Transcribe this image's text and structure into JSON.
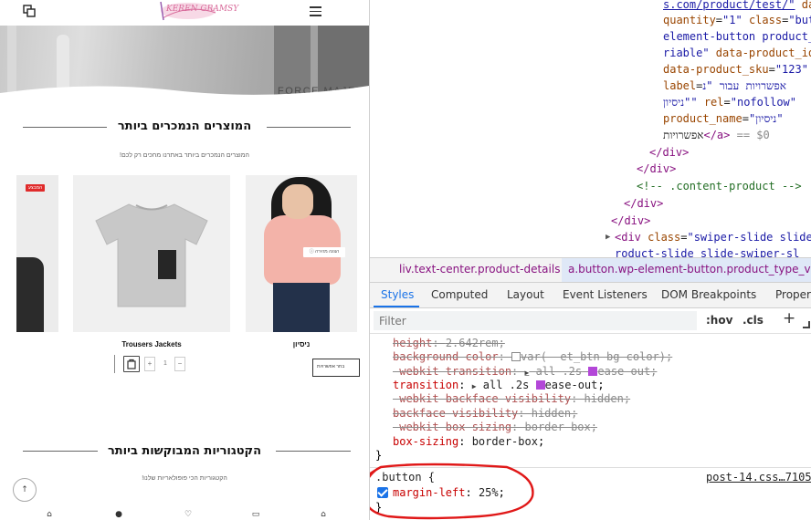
{
  "site": {
    "logo_text": "KEREN GRAMSY",
    "hero_text": "FORCE MAJEUR",
    "best_sellers_title": "המוצרים הנמכרים ביותר",
    "best_sellers_sub": "המוצרים הנמכרים ביותר באתרנו מחכים רק לכם!",
    "sale_badge": "המבצע",
    "product_2_name": "Trousers Jackets",
    "product_3_name": "ניסיון",
    "quick_view": "הצגה מהירה",
    "qty_plus": "+",
    "qty_value": "1",
    "qty_minus": "−",
    "options_label": "בחר אפשרויות",
    "categories_title": "הקטגוריות המבוקשות ביותר",
    "categories_sub": "הקטגוריות הכי פופולאריות שלנו!",
    "scroll_top_arrow": "↑"
  },
  "devtools": {
    "elements": {
      "line1": "s.com/product/test/\"",
      "line1_tail": " da",
      "line2_attr": "quantity",
      "line2_val": "\"1\"",
      "line2_attr2": " class",
      "line2_val2": "\"but",
      "line3": "element-button product_",
      "line4": "riable\"",
      "line4_attr": " data-product_id",
      "line5_attr": "data-product_sku",
      "line5_val": "\"123\"",
      "line6_val": "אפשרויות עבור \"נ",
      "line6_attr": "label",
      "line7_val": "ניסיון\"\"",
      "line7_attr": " rel",
      "line7_val2": "\"nofollow\"",
      "line8_attr": "product_name",
      "line8_val": "\"ניסיון\"",
      "line9_txt": "אפשרויות",
      "line9_close": "</a>",
      "line9_eq": " == $0",
      "close_div_1": "</div>",
      "close_div_2": "</div>",
      "comment": "<!-- .content-product -->",
      "close_div_3": "</div>",
      "close_div_4": "</div>",
      "swiper_open": "<div ",
      "swiper_attr": "class",
      "swiper_val": "\"swiper-slide slide",
      "swiper_next": "roduct-slide  slide-swiper-sl"
    },
    "breadcrumbs": {
      "crumb_1": "liv.text-center.product-details",
      "crumb_2": "a.button.wp-element-button.product_type_var"
    },
    "tabs": {
      "styles": "Styles",
      "computed": "Computed",
      "layout": "Layout",
      "event_listeners": "Event Listeners",
      "dom_breakpoints": "DOM Breakpoints",
      "properties": "Proper"
    },
    "filter": {
      "placeholder": "Filter",
      "hov": ":hov",
      "cls": ".cls",
      "plus": "+"
    },
    "styles": {
      "height_name": "height",
      "height_val": "2.642rem",
      "bg_name": "background-color",
      "bg_val": "var(--et_btn-bg-color)",
      "wkt_name": "-webkit-transition",
      "wkt_val": "all .2s",
      "wkt_val2": "ease-out",
      "t_name": "transition",
      "t_val": "all .2s",
      "t_val2": "ease-out",
      "wkbv_name": "-webkit-backface-visibility",
      "wkbv_val": "hidden",
      "bv_name": "backface-visibility",
      "bv_val": "hidden",
      "wkbs_name": "-webkit-box-sizing",
      "wkbs_val": "border-box",
      "bs_name": "box-sizing",
      "bs_val": "border-box",
      "close_brace_1": "}",
      "selector": ".button {",
      "source": "post-14.css…7105",
      "ml_name": "margin-left",
      "ml_val": "25%",
      "close_brace_2": "}"
    },
    "colors": {
      "tag": "#881280",
      "attr": "#994500",
      "value": "#1a1aa6",
      "accent": "#1a73e8",
      "annotation": "#e01818"
    }
  }
}
